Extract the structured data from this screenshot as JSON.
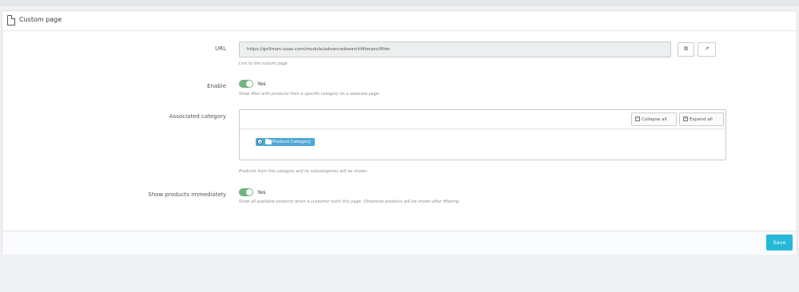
{
  "panel": {
    "title": "Custom page",
    "icon": "document-icon"
  },
  "url_field": {
    "label": "URL",
    "value": "https://grillman.uxas.com/module/advancedsearchfilterpro/filter",
    "help": "Link to the custom page.",
    "copy_icon": "copy-icon",
    "open_icon": "external-link-icon"
  },
  "enable_field": {
    "label": "Enable",
    "value": "Yes",
    "help": "Show filter with products from a specific category on a separate page."
  },
  "category_field": {
    "label": "Associated category",
    "collapse_label": "Collapse all",
    "expand_label": "Expand all",
    "tree_item": "Product Category",
    "help": "Products from this category and its subcategories will be shown."
  },
  "immediate_field": {
    "label": "Show products immediately",
    "value": "Yes",
    "help": "Show all available products when a customer visits this page. Otherwise products will be shown after filtering."
  },
  "footer": {
    "save_label": "Save"
  },
  "colors": {
    "toggle_on": "#70b580",
    "save_button": "#25b9d7",
    "tree_chip": "#4ea7d4"
  }
}
